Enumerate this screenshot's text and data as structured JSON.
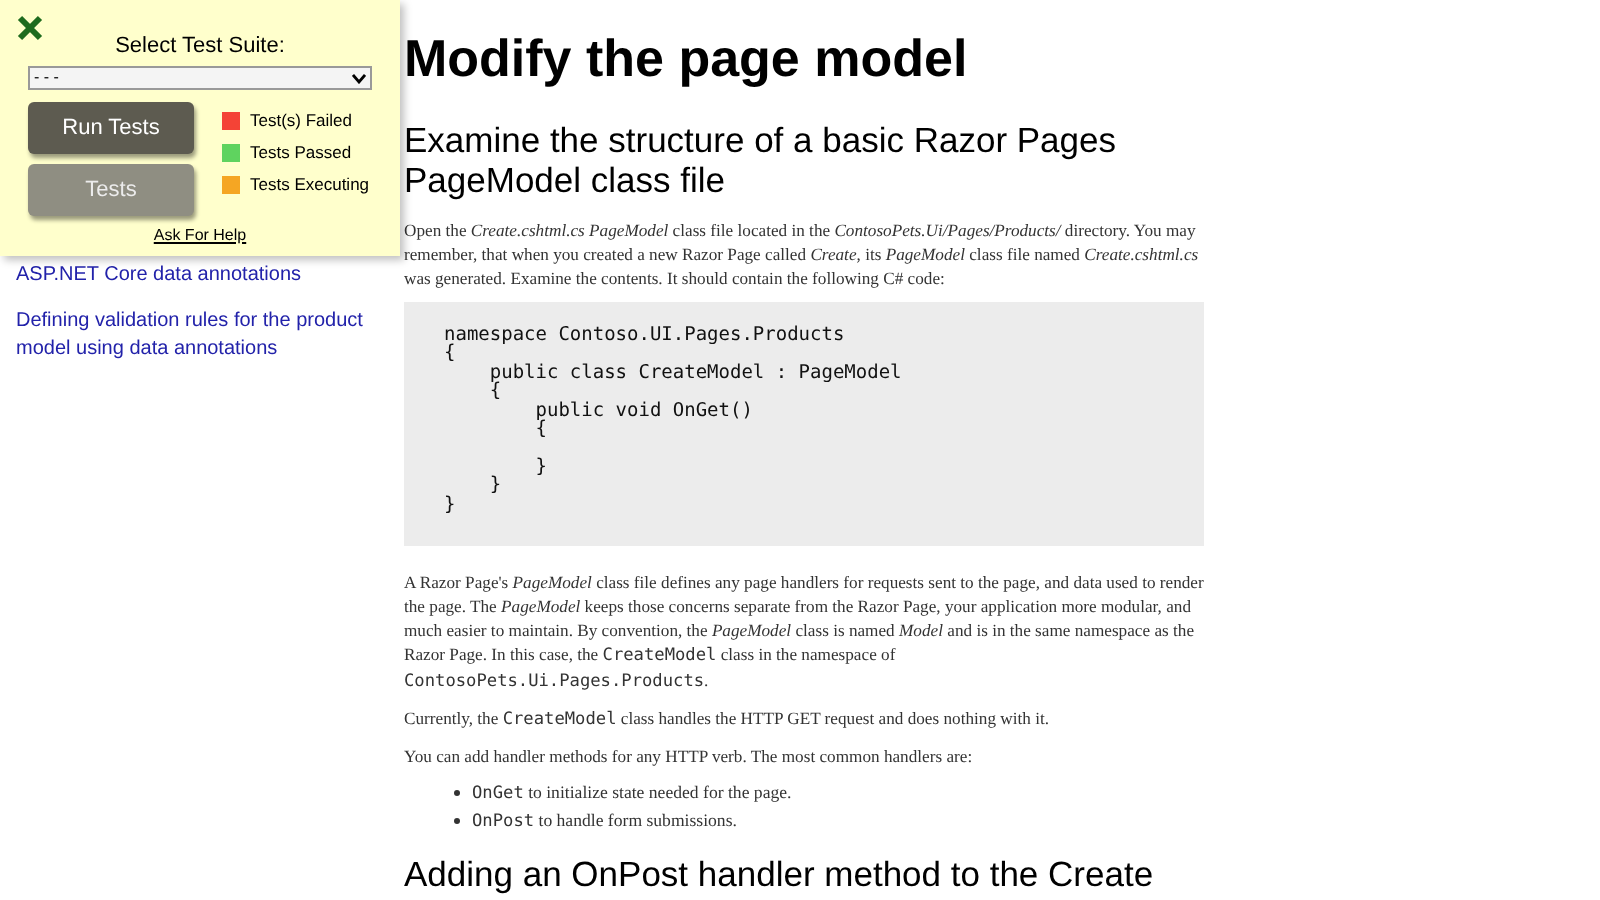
{
  "sidebar": {
    "links": [
      {
        "label": "ASP.NET Core data annotations"
      },
      {
        "label": "Defining validation rules for the product model using data annotations"
      }
    ]
  },
  "test_panel": {
    "title": "Select Test Suite:",
    "suite_select": {
      "value": "- - -"
    },
    "buttons": [
      {
        "label": "Run Tests",
        "disabled": false
      },
      {
        "label": "Tests",
        "disabled": true
      }
    ],
    "legend": [
      {
        "label": "Test(s) Failed",
        "color": "#f44336"
      },
      {
        "label": "Tests Passed",
        "color": "#5fd35f"
      },
      {
        "label": "Tests Executing",
        "color": "#f5a623"
      }
    ],
    "help_link": "Ask For Help"
  },
  "article": {
    "title": "Modify the page model",
    "sections": [
      {
        "heading": "Examine the structure of a basic Razor Pages PageModel class file",
        "blocks": [
          {
            "kind": "paragraph",
            "segments": [
              {
                "kind": "text",
                "text": "Open the *Create.cshtml.cs PageModel* class file located in the *ContosoPets.Ui/Pages/Products/* directory. You may remember, that when you created a new Razor Page called *Create*, its *PageModel* class file named *Create.cshtml.cs* was generated. Examine the contents. It should contain the following C# code:"
              }
            ]
          },
          {
            "kind": "code",
            "lines": [
              {
                "text": "namespace Contoso.UI.Pages.Products",
                "gap_before": false
              },
              {
                "text": "{",
                "gap_before": false
              },
              {
                "text": "    public class CreateModel : PageModel",
                "gap_before": false
              },
              {
                "text": "    {",
                "gap_before": false
              },
              {
                "text": "        public void OnGet()",
                "gap_before": false
              },
              {
                "text": "        {",
                "gap_before": false
              },
              {
                "text": "        }",
                "gap_before": true
              },
              {
                "text": "    }",
                "gap_before": false
              },
              {
                "text": "}",
                "gap_before": false
              }
            ]
          },
          {
            "kind": "paragraph",
            "segments": [
              {
                "kind": "text",
                "text": "A Razor Page's *PageModel* class file defines any page handlers for requests sent to the page, and data used to render the page. The *PageModel* keeps those concerns separate from the Razor Page, your application more modular, and much easier to maintain. By convention, the *PageModel* class is named *Model* and is in the same namespace as the Razor Page. In this case, the "
              },
              {
                "kind": "code",
                "text": "CreateModel"
              },
              {
                "kind": "text",
                "text": " class in the namespace of "
              },
              {
                "kind": "code",
                "text": "ContosoPets.Ui.Pages.Products"
              },
              {
                "kind": "text",
                "text": "."
              }
            ]
          },
          {
            "kind": "paragraph",
            "segments": [
              {
                "kind": "text",
                "text": "Currently, the "
              },
              {
                "kind": "code",
                "text": "CreateModel"
              },
              {
                "kind": "text",
                "text": " class handles the HTTP GET request and does nothing with it."
              }
            ]
          },
          {
            "kind": "paragraph",
            "segments": [
              {
                "kind": "text",
                "text": "You can add handler methods for any HTTP verb. The most common handlers are:"
              }
            ]
          },
          {
            "kind": "list",
            "items": [
              [
                {
                  "kind": "code",
                  "text": "OnGet"
                },
                {
                  "kind": "text",
                  "text": " to initialize state needed for the page."
                }
              ],
              [
                {
                  "kind": "code",
                  "text": "OnPost"
                },
                {
                  "kind": "text",
                  "text": " to handle form submissions."
                }
              ]
            ]
          }
        ]
      },
      {
        "heading": "Adding an OnPost handler method to the Create"
      }
    ]
  }
}
